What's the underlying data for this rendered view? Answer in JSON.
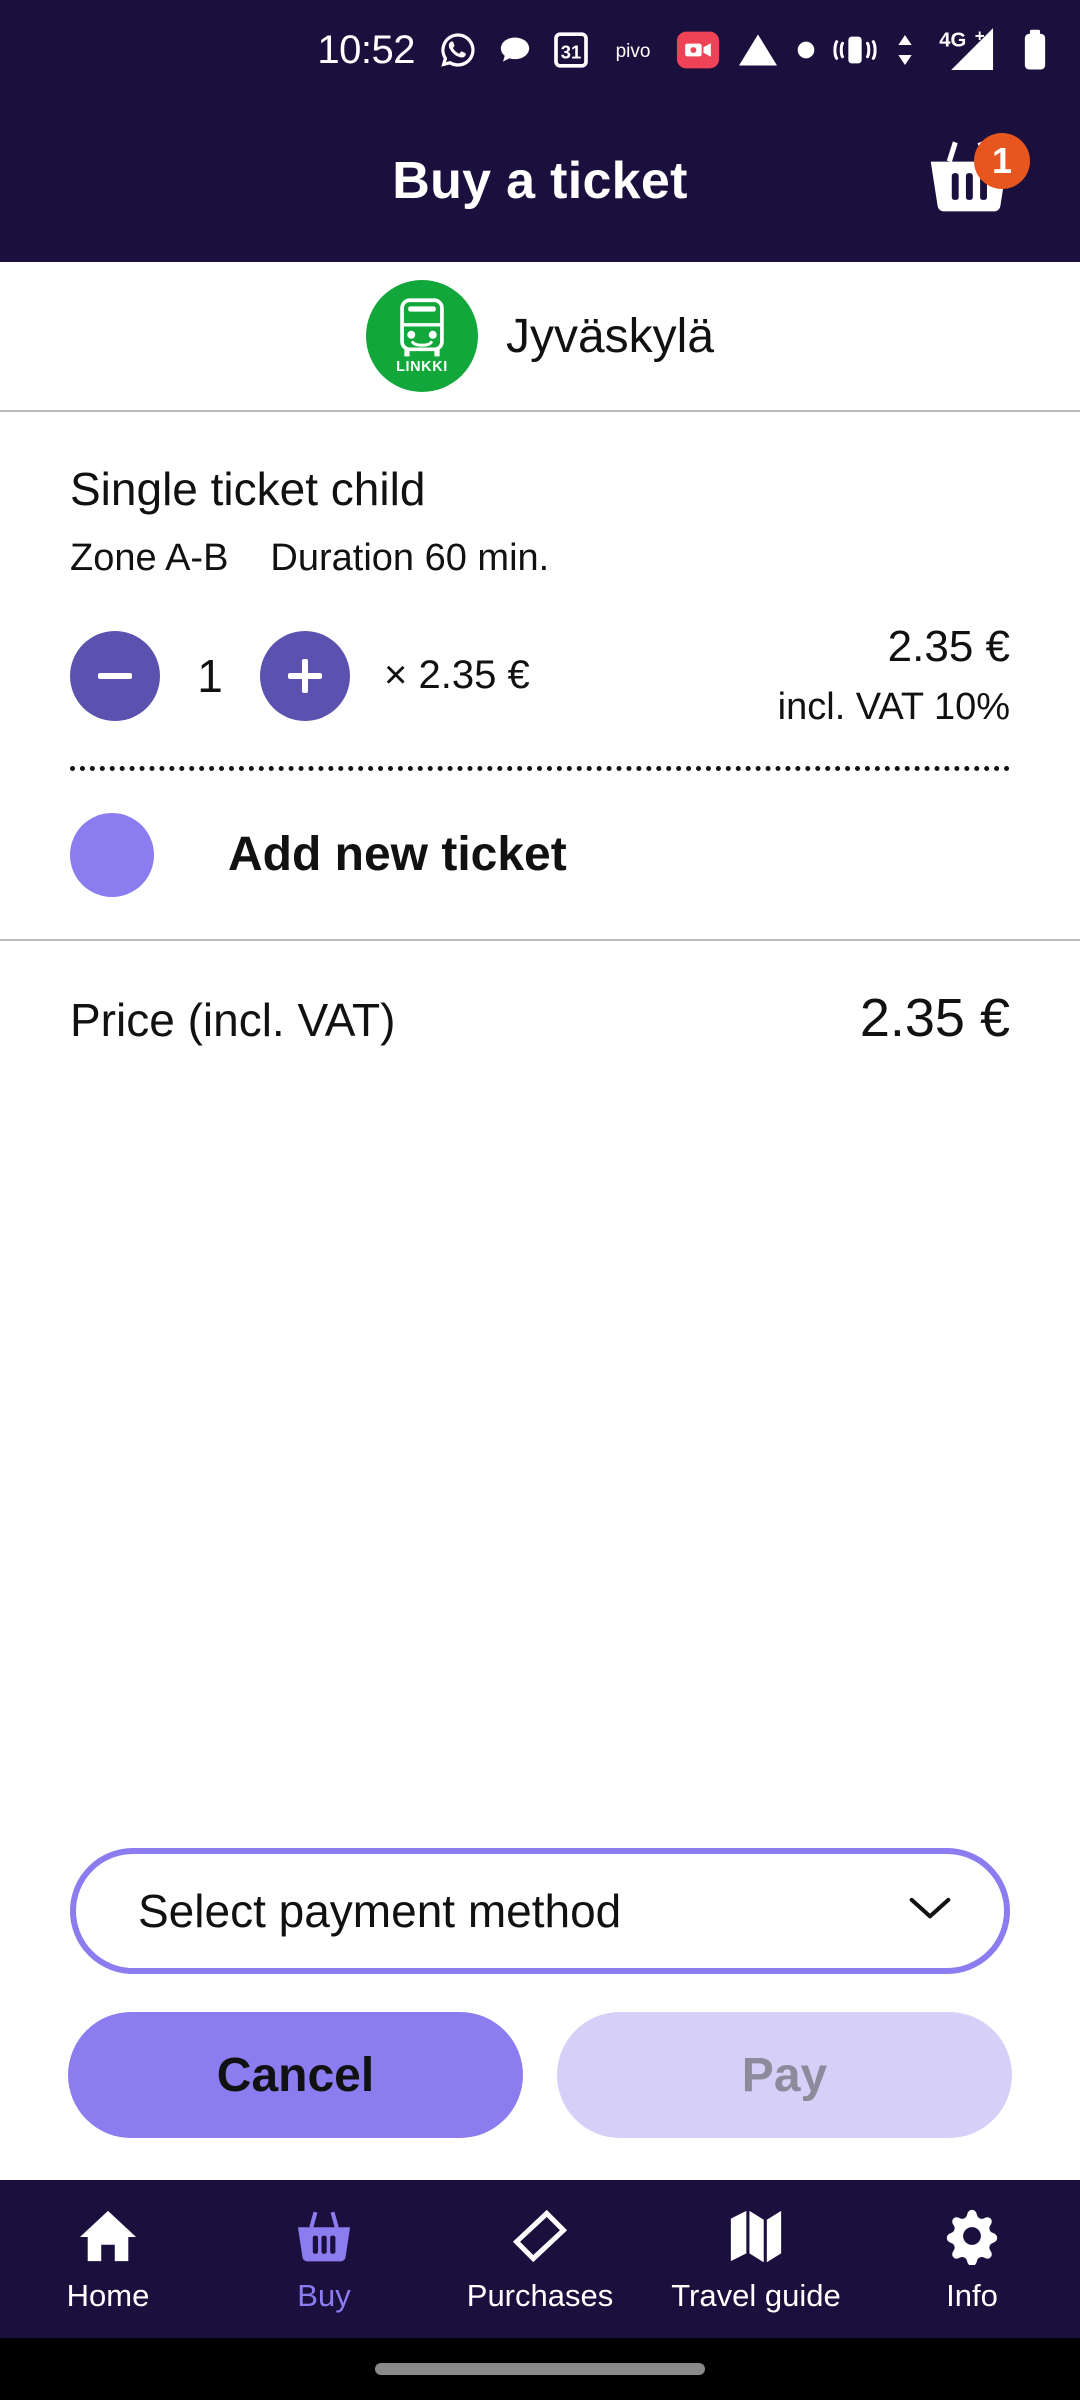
{
  "statusbar": {
    "time": "10:52",
    "icons": [
      {
        "name": "whatsapp-icon",
        "label": "WhatsApp"
      },
      {
        "name": "message-bubble-icon",
        "label": "Messages"
      },
      {
        "name": "calendar-icon",
        "label": "31"
      },
      {
        "name": "pivo-icon",
        "label": "pivo"
      },
      {
        "name": "screen-record-icon",
        "label": "Screen recorder"
      },
      {
        "name": "triangle-icon",
        "label": "App"
      },
      {
        "name": "dot-icon",
        "label": "Notification"
      },
      {
        "name": "vibrate-icon",
        "label": "Vibrate"
      },
      {
        "name": "mobile-data-icon",
        "label": "Data"
      },
      {
        "name": "signal-4g-icon",
        "label": "4G+"
      },
      {
        "name": "battery-icon",
        "label": "Battery"
      }
    ],
    "network_label": "4G+"
  },
  "header": {
    "title": "Buy a ticket",
    "cart_badge_count": "1",
    "cart_icon": "shopping-basket-icon"
  },
  "operator": {
    "logo_text": "LINKKI",
    "logo_icon": "bus-icon",
    "city": "Jyväskylä",
    "logo_color": "#12A73B"
  },
  "ticket": {
    "name": "Single ticket child",
    "zone": "Zone A-B",
    "duration": "Duration 60 min.",
    "decrement_label": "minus-icon",
    "increment_label": "plus-icon",
    "quantity": "1",
    "unit_price": "× 2.35 €",
    "line_total": "2.35 €",
    "vat_note": "incl. VAT 10%"
  },
  "add_ticket": {
    "icon": "plus-icon",
    "label": "Add new ticket"
  },
  "total": {
    "label": "Price  (incl. VAT)",
    "value": "2.35 €"
  },
  "payment": {
    "selected_label": "Select payment method",
    "chevron": "chevron-down-icon"
  },
  "actions": {
    "cancel_label": "Cancel",
    "pay_label": "Pay"
  },
  "bottom_nav": {
    "items": [
      {
        "label": "Home",
        "icon": "home-icon",
        "active": false
      },
      {
        "label": "Buy",
        "icon": "basket-icon",
        "active": true
      },
      {
        "label": "Purchases",
        "icon": "ticket-icon",
        "active": false
      },
      {
        "label": "Travel guide",
        "icon": "map-icon",
        "active": false
      },
      {
        "label": "Info",
        "icon": "gear-icon",
        "active": false
      }
    ]
  },
  "colors": {
    "nav_dark": "#1B0F3D",
    "accent_purple": "#8B7DF0",
    "stepper_purple": "#5B52B0",
    "badge_orange": "#E8561F",
    "disabled_purple": "#D6CFF8"
  }
}
